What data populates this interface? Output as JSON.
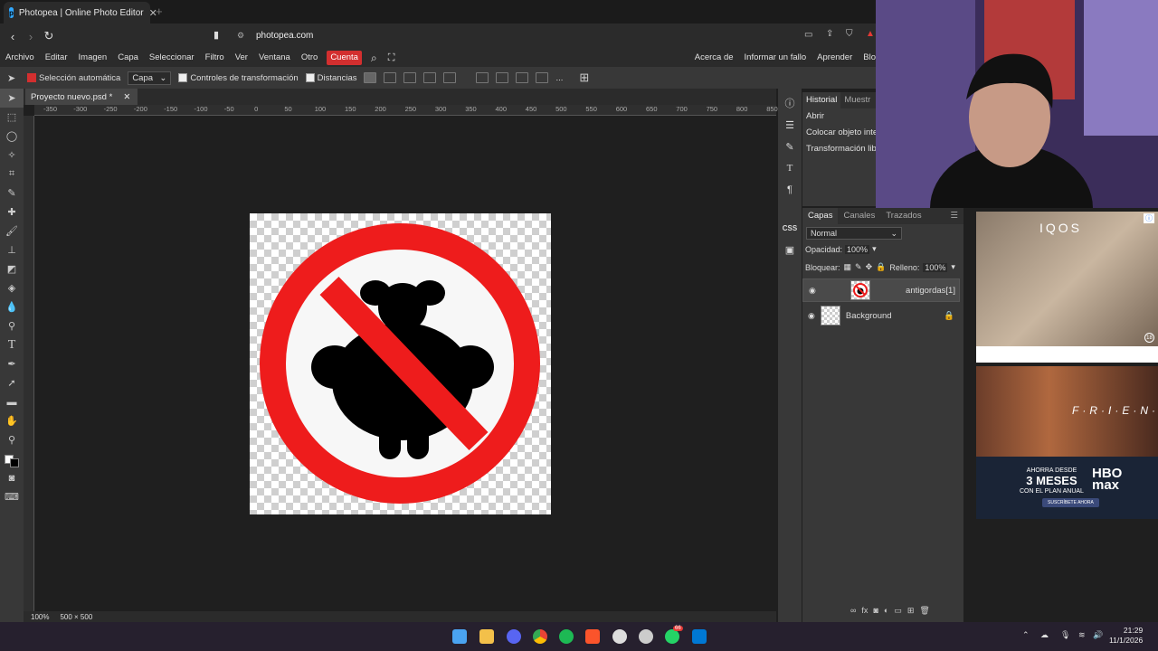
{
  "browser": {
    "tab_title": "Photopea | Online Photo Editor",
    "url": "photopea.com"
  },
  "menu": {
    "items": [
      "Archivo",
      "Editar",
      "Imagen",
      "Capa",
      "Seleccionar",
      "Filtro",
      "Ver",
      "Ventana",
      "Otro"
    ],
    "account": "Cuenta",
    "right": [
      "Acerca de",
      "Informar un fallo",
      "Aprender",
      "Blo"
    ]
  },
  "options": {
    "auto_select": "Selección automática",
    "target": "Capa",
    "transform_controls": "Controles de transformación",
    "distances": "Distancias",
    "more": "..."
  },
  "document": {
    "tab_title": "Proyecto nuevo.psd *",
    "ruler_labels": [
      "-350",
      "-300",
      "-250",
      "-200",
      "-150",
      "-100",
      "-50",
      "0",
      "50",
      "100",
      "150",
      "200",
      "250",
      "300",
      "350",
      "400",
      "450",
      "500",
      "550",
      "600",
      "650",
      "700",
      "750",
      "800",
      "850"
    ],
    "zoom": "100%",
    "size": "500 × 500"
  },
  "history": {
    "tabs": [
      "Historial",
      "Muestr"
    ],
    "items": [
      "Abrir",
      "Colocar objeto inte",
      "Transformación lib"
    ]
  },
  "layers": {
    "tabs": [
      "Capas",
      "Canales",
      "Trazados"
    ],
    "blend": "Normal",
    "opacity_label": "Opacidad:",
    "opacity_value": "100%",
    "lock_label": "Bloquear:",
    "fill_label": "Relleno:",
    "fill_value": "100%",
    "rows": [
      {
        "name": "antigordas[1]"
      },
      {
        "name": "Background"
      }
    ]
  },
  "ads": {
    "iqos_brand": "IQOS",
    "iqos_age": "18",
    "friends": "F·R·I·E·N·D·S",
    "promo_line1": "AHORRA DESDE",
    "promo_line2": "3 MESES",
    "promo_line3": "CON EL PLAN ANUAL",
    "hbo_logo": "HBO max",
    "cta": "SUSCRÍBETE AHORA"
  },
  "taskbar": {
    "time": "21:29",
    "date": "11/1/2026",
    "badge": "66"
  },
  "colors": {
    "accent": "#d32f2f",
    "panel": "#383838",
    "canvas_bg": "#1f1f1f",
    "sign_red": "#ee1c1c"
  }
}
